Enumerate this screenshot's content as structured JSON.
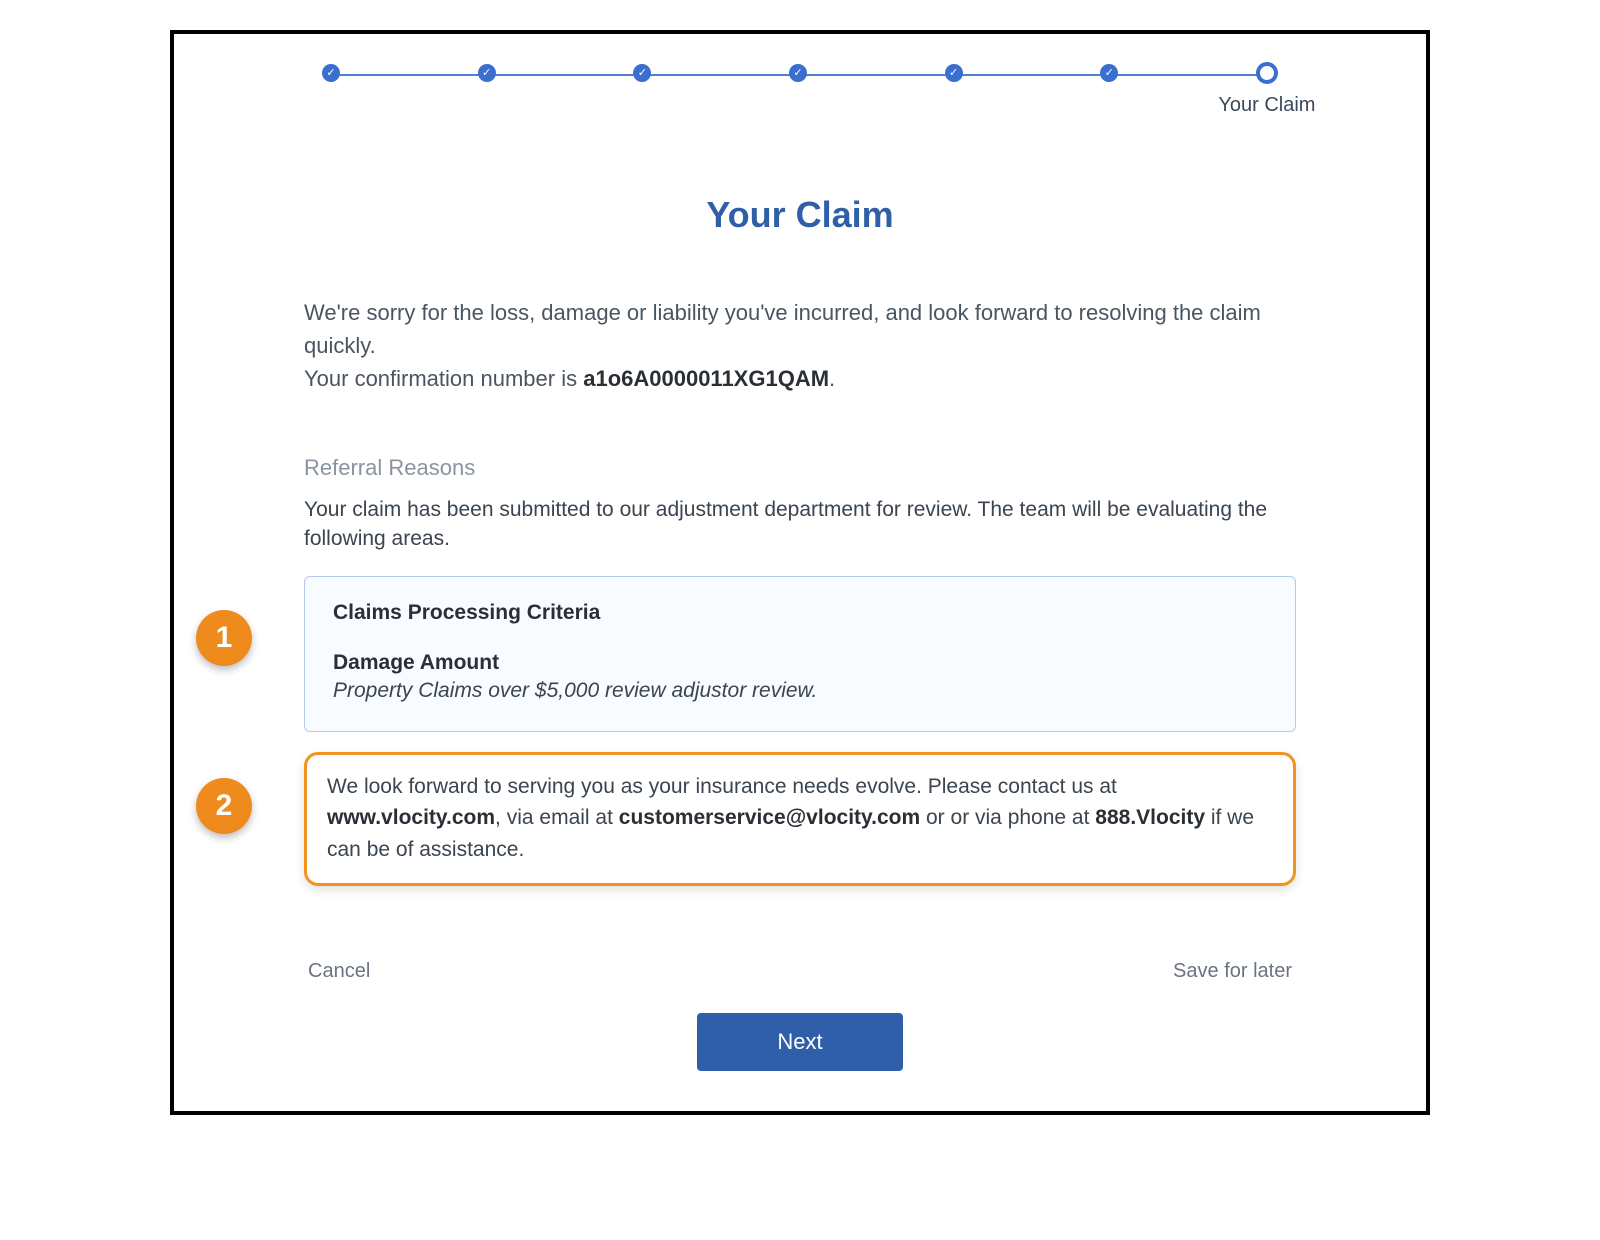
{
  "stepper": {
    "current_label": "Your Claim",
    "steps": 7
  },
  "title": "Your Claim",
  "intro": {
    "line1": "We're sorry for the loss, damage or liability you've incurred, and look forward to resolving the claim quickly.",
    "line2_prefix": "Your confirmation number is ",
    "confirmation_number": "a1o6A0000011XG1QAM",
    "line2_suffix": "."
  },
  "referral": {
    "label": "Referral Reasons",
    "subtext": "Your claim has been submitted to our adjustment department for review. The team will be evaluating the following areas.",
    "box_header": "Claims Processing Criteria",
    "item_title": "Damage Amount",
    "item_desc": "Property Claims over $5,000 review adjustor review."
  },
  "contact": {
    "p1": "We look forward to serving you as your insurance needs evolve. Please contact us at ",
    "website": "www.vlocity.com",
    "p2": ", via email at ",
    "email": "customerservice@vlocity.com",
    "p3": " or or via phone at ",
    "phone": "888.Vlocity",
    "p4": " if we can be of assistance."
  },
  "callouts": {
    "one": "1",
    "two": "2"
  },
  "actions": {
    "cancel": "Cancel",
    "save": "Save for later",
    "next": "Next"
  }
}
